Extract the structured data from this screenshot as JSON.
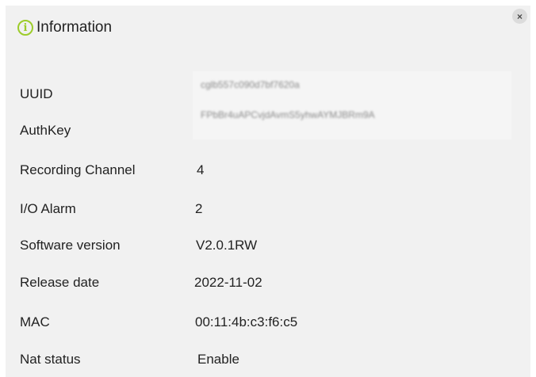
{
  "dialog": {
    "title": "Information",
    "close_label": "×"
  },
  "fields": {
    "uuid": {
      "label": "UUID",
      "value": "cglb557c090d7bf7620a"
    },
    "authkey": {
      "label": "AuthKey",
      "value": "FPbBr4uAPCvjdAvmS5yhwAYMJBRm9A"
    },
    "recording_channel": {
      "label": "Recording Channel",
      "value": "4"
    },
    "io_alarm": {
      "label": "I/O Alarm",
      "value": "2"
    },
    "software_version": {
      "label": "Software version",
      "value": "V2.0.1RW"
    },
    "release_date": {
      "label": "Release date",
      "value": "2022-11-02"
    },
    "mac": {
      "label": "MAC",
      "value": "00:11:4b:c3:f6:c5"
    },
    "nat_status": {
      "label": "Nat status",
      "value": "Enable"
    }
  },
  "icons": {
    "info": "info-circle-icon",
    "close": "close-icon"
  },
  "colors": {
    "accent": "#9ccc2a",
    "dialog_bg": "#f1f1f1"
  }
}
